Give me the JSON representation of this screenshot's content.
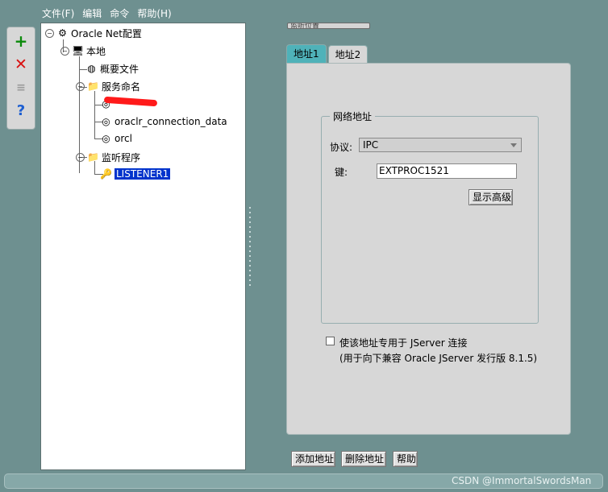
{
  "menu": {
    "items": [
      "文件(F)",
      "编辑",
      "命令",
      "帮助(H)"
    ]
  },
  "toolbar": {
    "add": "+",
    "delete": "✕",
    "test": "≡",
    "help": "?"
  },
  "tree": {
    "root": "Oracle Net配置",
    "local": "本地",
    "profile": "概要文件",
    "service_naming": "服务命名",
    "service_1": "oraclr_connection_data",
    "service_2": "orcl",
    "listener_group": "监听程序",
    "listener_1": "LISTENER1"
  },
  "header": {
    "pill": "监听位置"
  },
  "tabs": [
    {
      "label": "地址1",
      "active": false
    },
    {
      "label": "地址2",
      "active": true
    }
  ],
  "network": {
    "group_title": "网络地址",
    "protocol_label": "协议:",
    "protocol_value": "IPC",
    "key_label": "键:",
    "key_value": "EXTPROC1521",
    "advanced_button": "显示高级"
  },
  "option": {
    "checkbox_label": "使该地址专用于 JServer 连接",
    "sublabel": "(用于向下兼容 Oracle JServer 发行版 8.1.5)"
  },
  "buttons": {
    "add_address": "添加地址",
    "delete_address": "删除地址",
    "help": "帮助"
  },
  "watermark": "CSDN @ImmortalSwordsMan",
  "colors": {
    "background": "#6e9090",
    "selection": "#0033cc",
    "tab_inactive": "#4fb2b9",
    "redaction": "#ff1a1a"
  }
}
